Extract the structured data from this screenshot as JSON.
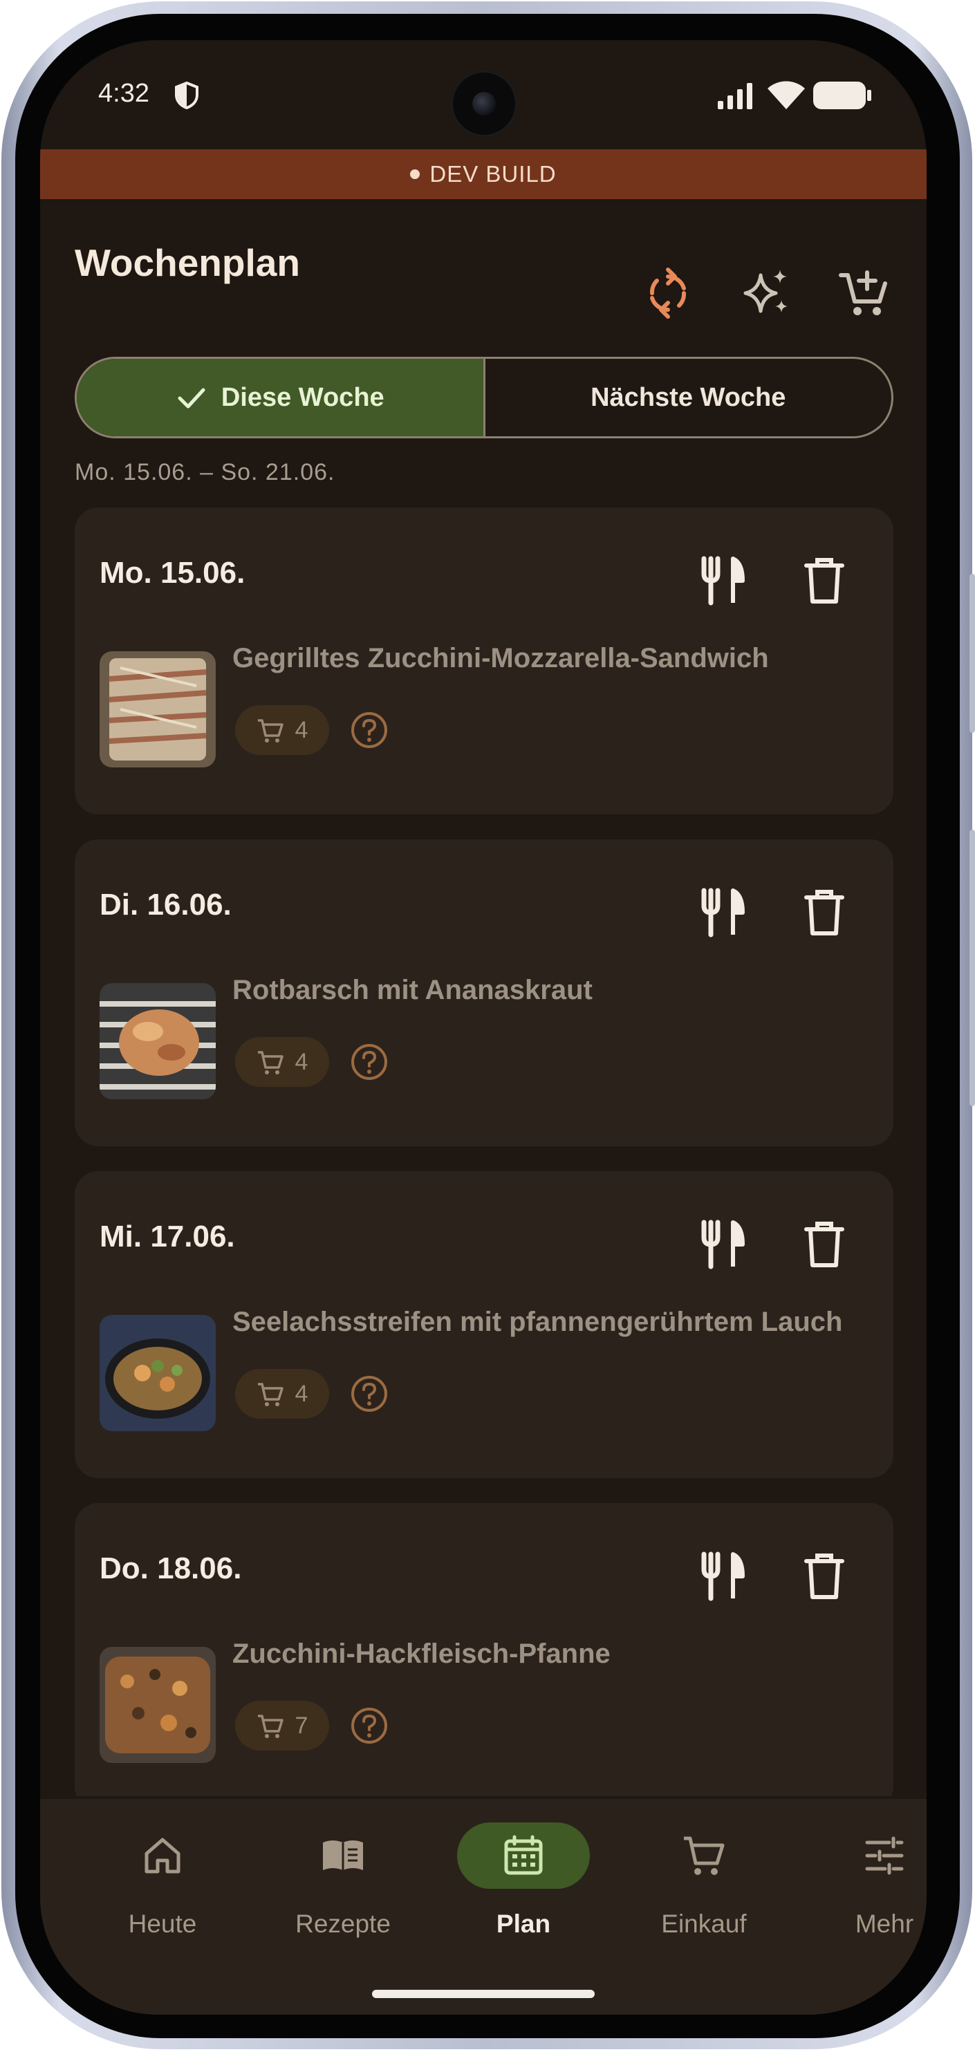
{
  "status_bar": {
    "time": "4:32"
  },
  "dev_banner": {
    "label": "DEV BUILD"
  },
  "header": {
    "title": "Wochenplan",
    "actions": [
      "sync-icon",
      "sparkles-icon",
      "add-to-cart-icon"
    ]
  },
  "week_toggle": {
    "this_week": "Diese Woche",
    "next_week": "Nächste Woche",
    "selected": "this_week"
  },
  "week_range": "Mo. 15.06. – So. 21.06.",
  "days": [
    {
      "day": "Mo. 15.06.",
      "meal": "Gegrilltes Zucchini-Mozzarella-Sandwich",
      "cart_count": "4"
    },
    {
      "day": "Di. 16.06.",
      "meal": "Rotbarsch mit Ananaskraut",
      "cart_count": "4"
    },
    {
      "day": "Mi. 17.06.",
      "meal": "Seelachsstreifen mit pfannengerührtem Lauch",
      "cart_count": "4"
    },
    {
      "day": "Do. 18.06.",
      "meal": "Zucchini-Hackfleisch-Pfanne",
      "cart_count": "7"
    }
  ],
  "nav": {
    "items": [
      {
        "label": "Heute",
        "icon": "home-icon"
      },
      {
        "label": "Rezepte",
        "icon": "book-icon"
      },
      {
        "label": "Plan",
        "icon": "calendar-icon",
        "active": true
      },
      {
        "label": "Einkauf",
        "icon": "cart-icon"
      },
      {
        "label": "Mehr",
        "icon": "sliders-icon"
      }
    ]
  },
  "colors": {
    "background": "#1e1712",
    "card": "#2b221c",
    "accent_green": "#415a27",
    "accent_orange": "#e8895a",
    "dev_banner": "#74341c"
  }
}
